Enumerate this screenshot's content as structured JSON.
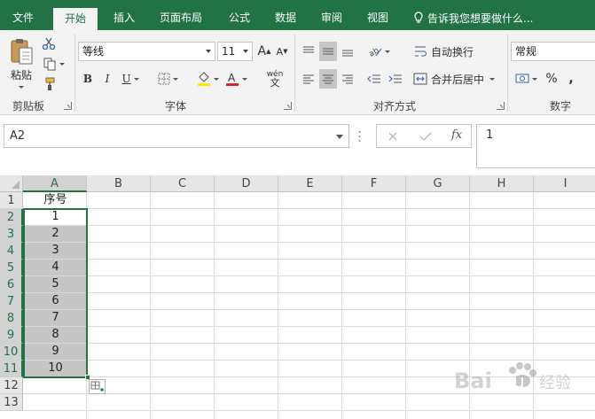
{
  "tabs": [
    {
      "label": "文件",
      "active": false
    },
    {
      "label": "开始",
      "active": true
    },
    {
      "label": "插入",
      "active": false
    },
    {
      "label": "页面布局",
      "active": false
    },
    {
      "label": "公式",
      "active": false
    },
    {
      "label": "数据",
      "active": false
    },
    {
      "label": "审阅",
      "active": false
    },
    {
      "label": "视图",
      "active": false
    }
  ],
  "tell_me": "告诉我您想要做什么...",
  "ribbon": {
    "clipboard": {
      "paste_label": "粘贴",
      "group_label": "剪贴板"
    },
    "font": {
      "font_name": "等线",
      "font_size": "11",
      "phonetic_label": "wén",
      "group_label": "字体"
    },
    "alignment": {
      "wrap_text": "自动换行",
      "merge_center": "合并后居中",
      "group_label": "对齐方式"
    },
    "number": {
      "format": "常规",
      "group_label": "数字"
    }
  },
  "formula_bar": {
    "name_box": "A2",
    "formula": "1"
  },
  "sheet": {
    "columns": [
      "A",
      "B",
      "C",
      "D",
      "E",
      "F",
      "G",
      "H",
      "I"
    ],
    "rows": [
      "1",
      "2",
      "3",
      "4",
      "5",
      "6",
      "7",
      "8",
      "9",
      "10",
      "11",
      "12",
      "13"
    ],
    "col_a_values": [
      "序号",
      "1",
      "2",
      "3",
      "4",
      "5",
      "6",
      "7",
      "8",
      "9",
      "10",
      "",
      ""
    ],
    "selection": "A2:A11"
  },
  "colors": {
    "accent": "#217346",
    "ribbon_bg": "#f3f3f3",
    "selection_fill": "#c6c6c6",
    "font_color_red": "#d62b2b",
    "highlight_yellow": "#ffe600"
  },
  "watermark": {
    "text": "Bai 经验"
  }
}
